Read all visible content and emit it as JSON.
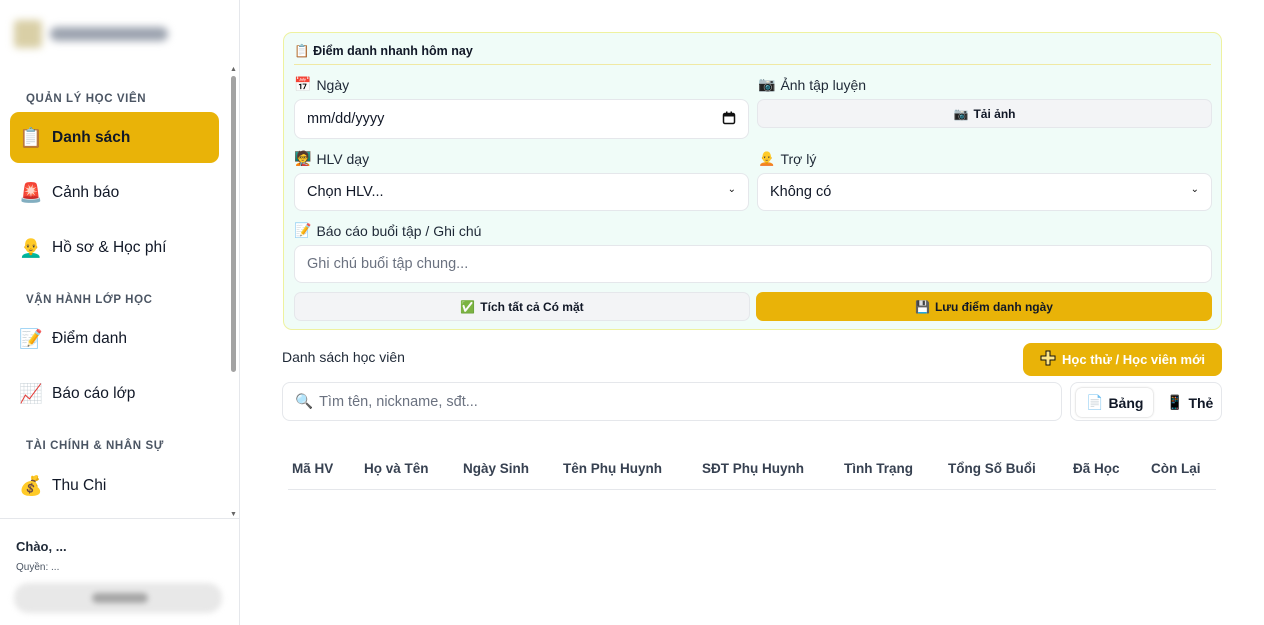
{
  "sidebar": {
    "sections": [
      {
        "title": "QUẢN LÝ HỌC VIÊN"
      },
      {
        "title": "VẬN HÀNH LỚP HỌC"
      },
      {
        "title": "TÀI CHÍNH & NHÂN SỰ"
      }
    ],
    "items": [
      {
        "icon": "📋",
        "label": "Danh sách"
      },
      {
        "icon": "🚨",
        "label": "Cảnh báo"
      },
      {
        "icon": "👨‍🦲",
        "label": "Hồ sơ & Học phí"
      },
      {
        "icon": "📝",
        "label": "Điểm danh"
      },
      {
        "icon": "📈",
        "label": "Báo cáo lớp"
      },
      {
        "icon": "💰",
        "label": "Thu Chi"
      }
    ],
    "active_item": "Danh sách",
    "accent": "#e9b308",
    "footer": {
      "greeting": "Chào, ...",
      "role": "Quyền: ..."
    }
  },
  "attendance": {
    "title_icon": "📋",
    "title": "Điểm danh nhanh hôm nay",
    "date": {
      "icon": "📅",
      "label": "Ngày",
      "value": "mm/dd/yyyy"
    },
    "photo": {
      "icon": "📷",
      "label": "Ảnh tập luyện",
      "button": "Tải ảnh",
      "button_icon": "📷"
    },
    "coach": {
      "icon": "🧑‍🏫",
      "label": "HLV dạy",
      "value": "Chọn HLV..."
    },
    "assistant": {
      "icon": "🧑‍🦲",
      "label": "Trợ lý",
      "value": "Không có"
    },
    "note": {
      "icon": "📝",
      "label": "Báo cáo buổi tập / Ghi chú",
      "placeholder": "Ghi chú buổi tập chung..."
    },
    "check_all": {
      "icon": "✅",
      "label": "Tích tất cả Có mặt"
    },
    "save": {
      "icon": "💾",
      "label": "Lưu điểm danh ngày"
    }
  },
  "students": {
    "title": "Danh sách học viên",
    "add_button": "Học thử / Học viên mới",
    "add_icon": "➕",
    "search_icon": "🔍",
    "search_placeholder": "Tìm tên, nickname, sđt...",
    "views": [
      {
        "icon": "📄",
        "label": "Bảng",
        "active": true
      },
      {
        "icon": "📱",
        "label": "Thẻ",
        "active": false
      }
    ],
    "columns": [
      "Mã HV",
      "Họ và Tên",
      "Ngày Sinh",
      "Tên Phụ Huynh",
      "SĐT Phụ Huynh",
      "Tình Trạng",
      "Tổng Số Buổi",
      "Đã Học",
      "Còn Lại"
    ]
  }
}
